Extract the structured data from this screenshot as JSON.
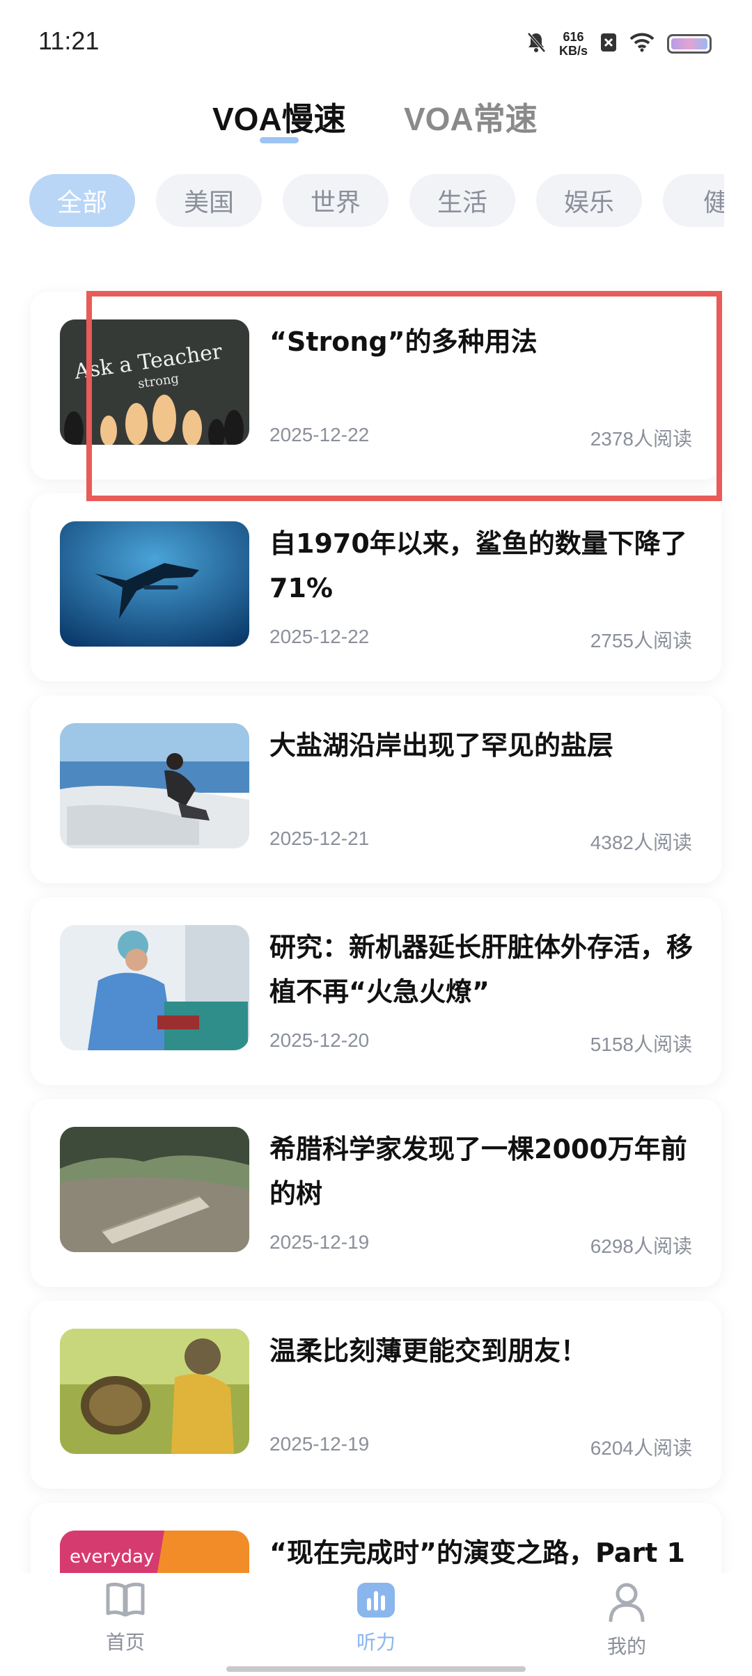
{
  "status": {
    "time": "11:21",
    "net_speed": "616",
    "net_unit": "KB/s"
  },
  "tabs": [
    {
      "label": "VOA慢速",
      "active": true
    },
    {
      "label": "VOA常速",
      "active": false
    }
  ],
  "categories": [
    "全部",
    "美国",
    "世界",
    "生活",
    "娱乐",
    "健"
  ],
  "articles": [
    {
      "title": "“Strong”的多种用法",
      "date": "2025-12-22",
      "reads": "2378人阅读",
      "thumb_text": "Ask a Teacher",
      "thumb_sub": "strong"
    },
    {
      "title": "自1970年以来，鲨鱼的数量下降了71%",
      "date": "2025-12-22",
      "reads": "2755人阅读"
    },
    {
      "title": "大盐湖沿岸出现了罕见的盐层",
      "date": "2025-12-21",
      "reads": "4382人阅读"
    },
    {
      "title": "研究：新机器延长肝脏体外存活，移植不再“火急火燎”",
      "date": "2025-12-20",
      "reads": "5158人阅读"
    },
    {
      "title": "希腊科学家发现了一棵2000万年前的树",
      "date": "2025-12-19",
      "reads": "6298人阅读"
    },
    {
      "title": "温柔比刻薄更能交到朋友！",
      "date": "2025-12-19",
      "reads": "6204人阅读"
    },
    {
      "title": "“现在完成时”的演变之路，Part 1",
      "date": "",
      "reads": "",
      "thumb_text": "everyday"
    }
  ],
  "bottom_nav": [
    {
      "label": "首页",
      "icon": "book-icon",
      "active": false
    },
    {
      "label": "听力",
      "icon": "bar-chart-icon",
      "active": true
    },
    {
      "label": "我的",
      "icon": "person-icon",
      "active": false
    }
  ],
  "colors": {
    "accent": "#8ab6ee",
    "chip_active": "#b9d6f6",
    "highlight": "#e85b58"
  }
}
